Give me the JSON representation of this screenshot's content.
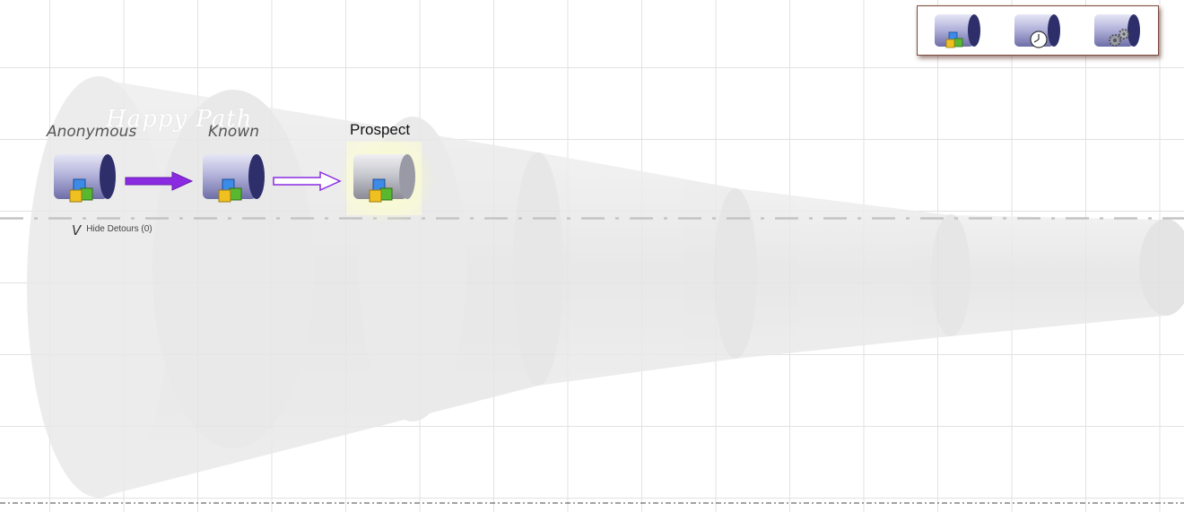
{
  "diagram": {
    "watermark_text": "Happy Path",
    "stages": [
      {
        "label": "Anonymous",
        "icon": "stage-blocks-icon",
        "active": false
      },
      {
        "label": "Known",
        "icon": "stage-blocks-icon",
        "active": false
      },
      {
        "label": "Prospect",
        "icon": "stage-blocks-icon",
        "active": true
      }
    ],
    "connectors": [
      {
        "from": "Anonymous",
        "to": "Known",
        "style": "solid",
        "color": "#8a2be2"
      },
      {
        "from": "Known",
        "to": "Prospect",
        "style": "outline",
        "color": "#8a2be2"
      }
    ],
    "detours_toggle": {
      "chevron": "V",
      "label": "Hide Detours (0)"
    }
  },
  "palette": {
    "items": [
      {
        "name": "stage-blocks-icon"
      },
      {
        "name": "stage-clock-icon"
      },
      {
        "name": "stage-gears-icon"
      }
    ]
  },
  "colors": {
    "connector": "#8a2be2",
    "highlight": "#f0fa96",
    "palette_border": "#7a4a3a"
  }
}
